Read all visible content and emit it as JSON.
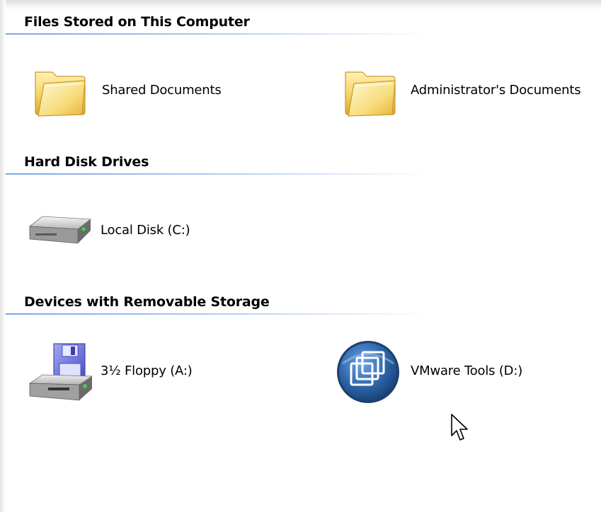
{
  "groups": [
    {
      "header": "Files Stored on This Computer",
      "items": [
        {
          "label": "Shared Documents",
          "icon": "folder-icon"
        },
        {
          "label": "Administrator's Documents",
          "icon": "folder-icon"
        }
      ]
    },
    {
      "header": "Hard Disk Drives",
      "items": [
        {
          "label": "Local Disk (C:)",
          "icon": "hard-disk-icon"
        }
      ]
    },
    {
      "header": "Devices with Removable Storage",
      "items": [
        {
          "label": "3½ Floppy (A:)",
          "icon": "floppy-drive-icon"
        },
        {
          "label": "VMware Tools (D:)",
          "icon": "vmware-cd-icon"
        }
      ]
    }
  ],
  "colors": {
    "header_rule": "#7aa7e6",
    "folder": "#f6d66a",
    "vmware_disc": "#2d64a8"
  }
}
